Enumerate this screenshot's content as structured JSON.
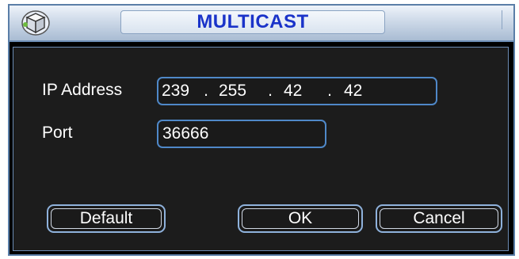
{
  "dialog": {
    "title": "MULTICAST",
    "title_icon": "network-cube-icon"
  },
  "form": {
    "ip_label": "IP Address",
    "ip_octets": [
      "239",
      "255",
      "42",
      "42"
    ],
    "ip_separator": ".",
    "port_label": "Port",
    "port_value": "36666"
  },
  "buttons": {
    "default_label": "Default",
    "ok_label": "OK",
    "cancel_label": "Cancel"
  },
  "colors": {
    "title_text": "#1a33c9",
    "field_border": "#4f88c8",
    "background": "#000000"
  }
}
